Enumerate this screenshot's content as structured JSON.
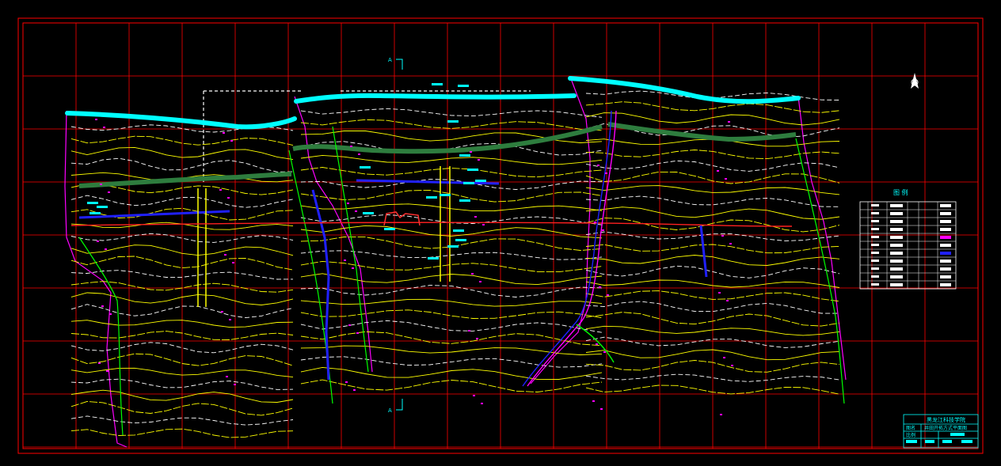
{
  "drawing": {
    "section_mark_top": "A",
    "section_mark_bottom": "A",
    "north_arrow_label": "N",
    "legend": {
      "title": "图  例"
    },
    "title_block": {
      "school": "黑龙江科技学院",
      "label_name": "图名",
      "drawing_name": "井田开拓方式平面图",
      "label_scale": "比例"
    }
  },
  "colors": {
    "frame": "#ff0000",
    "grid": "#ff0000",
    "contour_yellow": "#ffff00",
    "contour_white": "#ffffff",
    "river_cyan": "#00ffff",
    "fault_green": "#00ff00",
    "boundary_magenta": "#ff00ff",
    "roadway_blue": "#2020ff",
    "seam_green": "#2e7d3e",
    "text_cyan": "#00ffff"
  }
}
